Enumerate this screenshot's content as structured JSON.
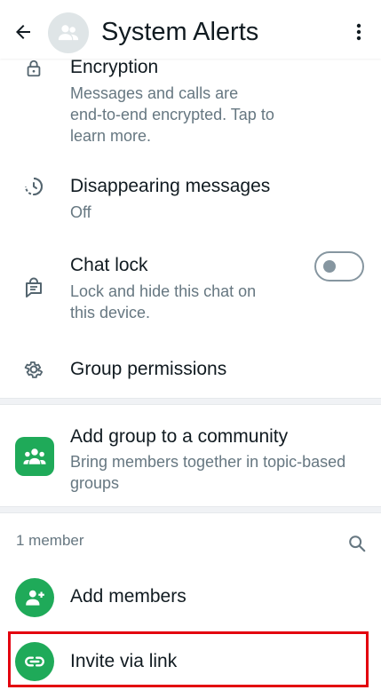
{
  "header": {
    "title": "System Alerts",
    "back_icon": "arrow-left-icon",
    "avatar_icon": "group-avatar-icon",
    "menu_icon": "more-vert-icon"
  },
  "settings": {
    "encryption": {
      "title": "Encryption",
      "subtitle_lines": [
        "Messages and calls are",
        "end-to-end encrypted. Tap to",
        "learn more."
      ]
    },
    "disappearing": {
      "title": "Disappearing messages",
      "subtitle": "Off"
    },
    "chat_lock": {
      "title": "Chat lock",
      "subtitle_lines": [
        "Lock and hide this chat on",
        "this device."
      ],
      "toggle_on": false
    },
    "group_permissions": {
      "title": "Group permissions"
    }
  },
  "community": {
    "title": "Add group to a community",
    "subtitle_lines": [
      "Bring members together in topic-based",
      "groups"
    ]
  },
  "members": {
    "count_label": "1 member",
    "add_label": "Add members",
    "invite_label": "Invite via link"
  },
  "colors": {
    "accent_green": "#1faa59",
    "highlight_red": "#e3000f",
    "secondary_text": "#667781"
  }
}
